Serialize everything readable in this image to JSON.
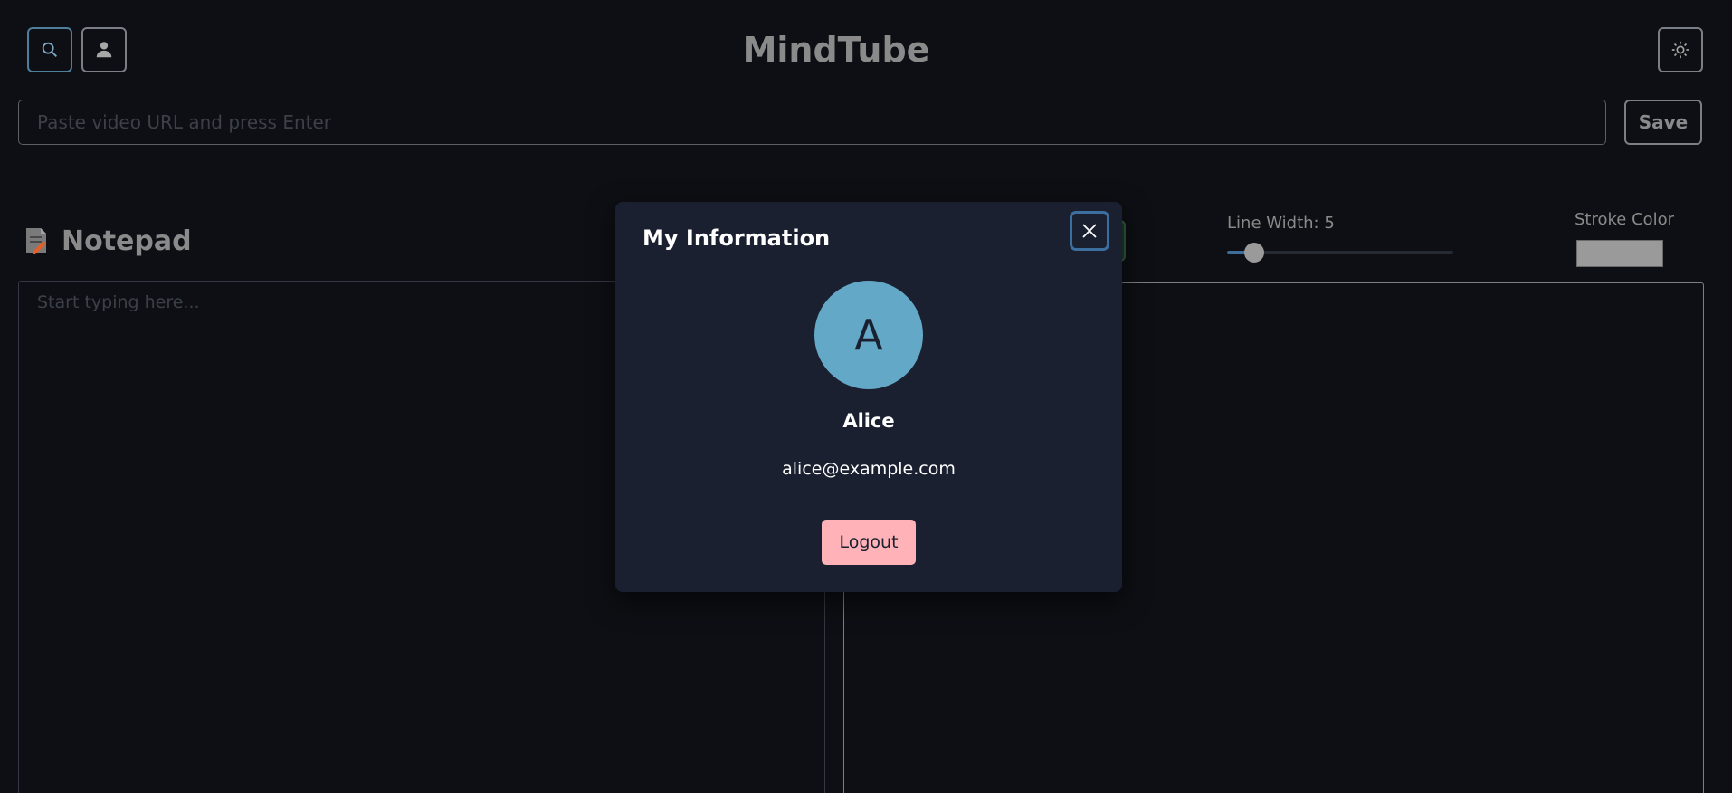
{
  "app": {
    "title": "MindTube"
  },
  "header": {
    "search_icon": "search-icon",
    "user_icon": "user-icon",
    "theme_icon": "sun-icon"
  },
  "url_bar": {
    "placeholder": "Paste video URL and press Enter",
    "value": "",
    "save_label": "Save"
  },
  "notepad": {
    "title": "Notepad",
    "icon": "notepad-icon",
    "placeholder": "Start typing here...",
    "value": ""
  },
  "drawing": {
    "line_width_label": "Line Width: 5",
    "line_width_fraction": 0.12,
    "stroke_color_label": "Stroke Color",
    "stroke_color": "#9a9a9a"
  },
  "modal": {
    "title": "My Information",
    "close_icon": "close-icon",
    "avatar_letter": "A",
    "avatar_color": "#64a8c8",
    "name": "Alice",
    "email": "alice@example.com",
    "logout_label": "Logout",
    "logout_color": "#ffb3b8"
  }
}
